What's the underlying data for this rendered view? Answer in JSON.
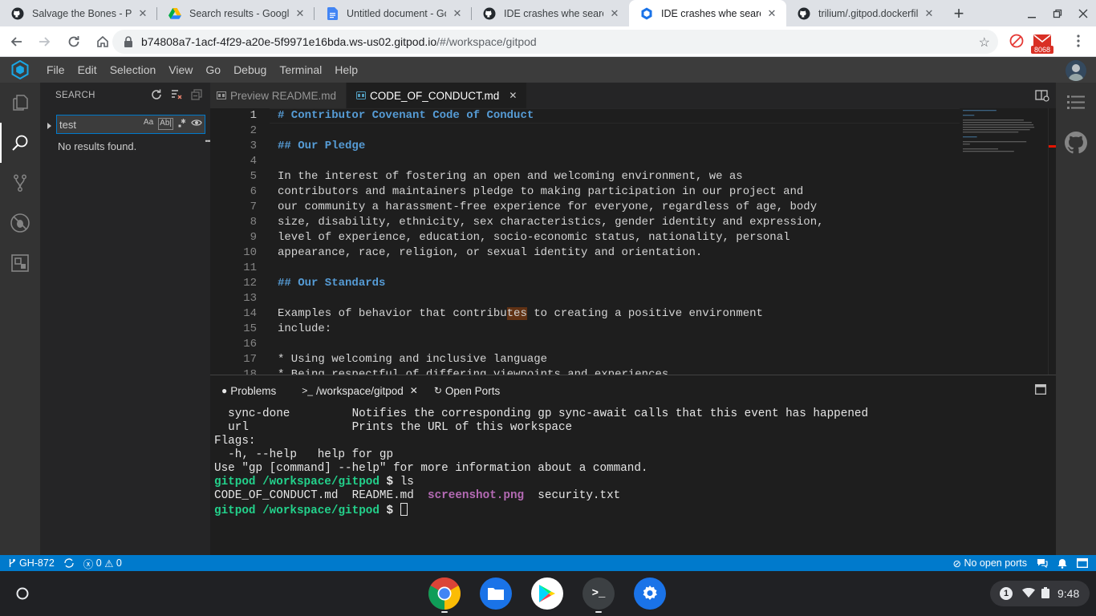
{
  "browser": {
    "tabs": [
      {
        "title": "Salvage the Bones - PDF",
        "favicon": "github-icon",
        "active": false
      },
      {
        "title": "Search results - Google D",
        "favicon": "google-drive-icon",
        "active": false
      },
      {
        "title": "Untitled document - Goo",
        "favicon": "google-docs-icon",
        "active": false
      },
      {
        "title": "IDE crashes whe searchi",
        "favicon": "github-icon",
        "active": false
      },
      {
        "title": "IDE crashes whe searchi",
        "favicon": "gitpod-icon",
        "active": true
      },
      {
        "title": "trilium/.gitpod.dockerfile",
        "favicon": "github-icon",
        "active": false
      }
    ],
    "tab_close": "✕",
    "new_tab": "+",
    "url_host": "b74808a7-1acf-4f29-a20e-5f9971e16bda.ws-us02.gitpod.io",
    "url_path": "/#/workspace/gitpod",
    "badge_count": "8068"
  },
  "ide": {
    "menu": [
      "File",
      "Edit",
      "Selection",
      "View",
      "Go",
      "Debug",
      "Terminal",
      "Help"
    ],
    "sidebar": {
      "title": "SEARCH",
      "query": "test",
      "opt_case": "Aa",
      "opt_word": "Ab|",
      "opt_more": "•••",
      "no_results": "No results found."
    },
    "editor_tabs": [
      {
        "label": "Preview README.md",
        "active": false
      },
      {
        "label": "CODE_OF_CONDUCT.md",
        "active": true
      }
    ],
    "lines": [
      {
        "n": "1",
        "text": "# Contributor Covenant Code of Conduct",
        "heading": true
      },
      {
        "n": "2",
        "text": "",
        "heading": false
      },
      {
        "n": "3",
        "text": "## Our Pledge",
        "heading": true
      },
      {
        "n": "4",
        "text": "",
        "heading": false
      },
      {
        "n": "5",
        "text": "In the interest of fostering an open and welcoming environment, we as",
        "heading": false
      },
      {
        "n": "6",
        "text": "contributors and maintainers pledge to making participation in our project and",
        "heading": false
      },
      {
        "n": "7",
        "text": "our community a harassment-free experience for everyone, regardless of age, body",
        "heading": false
      },
      {
        "n": "8",
        "text": "size, disability, ethnicity, sex characteristics, gender identity and expression,",
        "heading": false
      },
      {
        "n": "9",
        "text": "level of experience, education, socio-economic status, nationality, personal",
        "heading": false
      },
      {
        "n": "10",
        "text": "appearance, race, religion, or sexual identity and orientation.",
        "heading": false
      },
      {
        "n": "11",
        "text": "",
        "heading": false
      },
      {
        "n": "12",
        "text": "## Our Standards",
        "heading": true
      },
      {
        "n": "13",
        "text": "",
        "heading": false
      },
      {
        "n": "14",
        "text": "Examples of behavior that contributes to creating a positive environment",
        "heading": false
      },
      {
        "n": "15",
        "text": "include:",
        "heading": false
      },
      {
        "n": "16",
        "text": "",
        "heading": false
      },
      {
        "n": "17",
        "text": "* Using welcoming and inclusive language",
        "heading": false
      },
      {
        "n": "18",
        "text": "* Being respectful of differing viewpoints and experiences",
        "heading": false
      }
    ],
    "panel": {
      "tabs": [
        {
          "label": "Problems",
          "glyph": "●"
        },
        {
          "label": "/workspace/gitpod",
          "glyph": ">_"
        },
        {
          "label": "Open Ports",
          "glyph": "↻"
        }
      ],
      "terminal": {
        "l1": "  sync-done         Notifies the corresponding gp sync-await calls that this event has happened",
        "l2": "  url               Prints the URL of this workspace",
        "l3": "",
        "l4": "Flags:",
        "l5": "  -h, --help   help for gp",
        "l6": "",
        "l7": "Use \"gp [command] --help\" for more information about a command.",
        "prompt_user": "gitpod",
        "prompt_path": "/workspace/gitpod",
        "prompt_sym": "$",
        "cmd": " ls",
        "files": [
          "CODE_OF_CONDUCT.md",
          "README.md",
          "screenshot.png",
          "security.txt"
        ]
      }
    },
    "status": {
      "branch": "GH-872",
      "errors": "0",
      "warnings": "0",
      "ports": "No open ports"
    }
  },
  "os": {
    "notifications": "1",
    "time": "9:48"
  },
  "colors": {
    "accent": "#007acc",
    "heading": "#569cd6",
    "term_green": "#23d18b",
    "term_magenta": "#b46ab4"
  }
}
